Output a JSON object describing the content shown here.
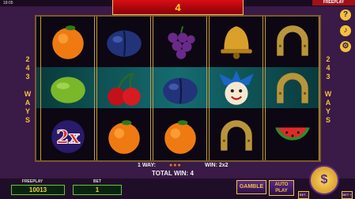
{
  "status_bar": {
    "time": "18:05"
  },
  "mode_tag": "FREEPLAY",
  "win_banner": "4",
  "ways_label_left": [
    "2",
    "4",
    "3",
    "",
    "W",
    "A",
    "Y",
    "S"
  ],
  "ways_label_right": [
    "2",
    "4",
    "3",
    "",
    "W",
    "A",
    "Y",
    "S"
  ],
  "reels": [
    [
      "orange",
      "lime",
      "2x"
    ],
    [
      "plum",
      "cherry",
      "orange"
    ],
    [
      "grapes",
      "plum",
      "orange"
    ],
    [
      "bell",
      "joker",
      "horseshoe"
    ],
    [
      "horseshoe",
      "horseshoe",
      "watermelon"
    ]
  ],
  "win_info": {
    "ways_text": "1 WAY:",
    "win_text": "WIN: 2x2",
    "total_text": "TOTAL WIN: 4"
  },
  "freeplay": {
    "label": "FREEPLAY",
    "value": "10013"
  },
  "bet": {
    "label": "BET",
    "value": "1"
  },
  "buttons": {
    "gamble": "GAMBLE",
    "autoplay": "AUTO PLAY",
    "spin_icon": "$"
  },
  "bet_minus": "BET -",
  "bet_plus": "BET +",
  "side_icons": [
    "help-icon",
    "sound-icon",
    "settings-icon"
  ],
  "colors": {
    "accent": "#f3c23a",
    "banner": "#d80e14",
    "background": "#3a1a46"
  }
}
